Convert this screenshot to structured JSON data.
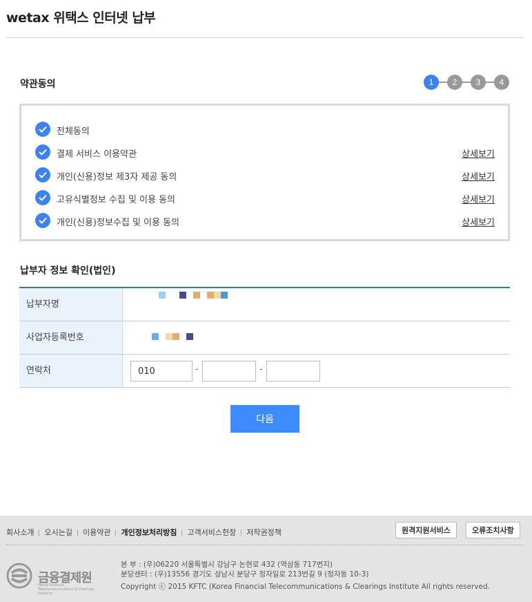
{
  "header": {
    "title": "wetax 위택스 인터넷 납부"
  },
  "terms": {
    "section_title": "약관동의",
    "steps": [
      "1",
      "2",
      "3",
      "4"
    ],
    "active_step": 1,
    "items": [
      {
        "label": "전체동의",
        "detail": ""
      },
      {
        "label": "결제 서비스 이용약관",
        "detail": "상세보기"
      },
      {
        "label": "개인(신용)정보 제3자 제공 동의",
        "detail": "상세보기"
      },
      {
        "label": "고유식별정보 수집 및 이용 동의",
        "detail": "상세보기"
      },
      {
        "label": "개인(신용)정보수집 및 이용 동의",
        "detail": "상세보기"
      }
    ]
  },
  "payer": {
    "section_title": "납부자 정보 확인(법인)",
    "rows": [
      {
        "label": "납부자명"
      },
      {
        "label": "사업자등록번호"
      },
      {
        "label": "연락처"
      }
    ],
    "phone": {
      "part1": "010",
      "part2": "",
      "part3": "",
      "separator": "-"
    }
  },
  "actions": {
    "next_label": "다음"
  },
  "footer": {
    "links": [
      "회사소개",
      "오시는길",
      "이용약관",
      "개인정보처리방침",
      "고객서비스헌장",
      "저작권정책"
    ],
    "buttons": [
      "원격지원서비스",
      "오류조치사항"
    ],
    "logo_name": "금융결제원",
    "logo_sub": "Korea Financial Telecommunications & Clearings Institute",
    "address_main": "본  부 : (우)06220 서울특별시 강남구 논현로 432 (역삼동 717번지)",
    "address_branch": "분당센터 : (우)13556 경기도 성남시 분당구 정자일로 213번길 9 (정자동 10-3)",
    "copyright": "Copyright ⓒ 2015 KFTC (Korea Financial Telecommunications & Clearings Institute All rights reserved."
  },
  "colors": {
    "accent": "#3d82f0",
    "button": "#3d8bfd",
    "table_border": "#3a6fb5",
    "label_bg": "#eaf2fb"
  }
}
